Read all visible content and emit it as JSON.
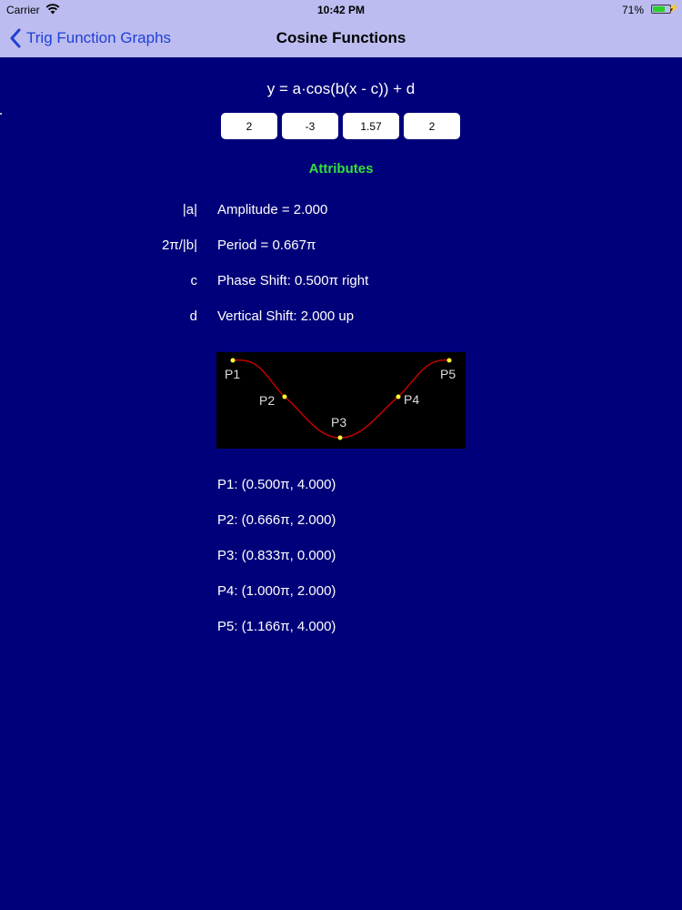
{
  "status_bar": {
    "carrier": "Carrier",
    "time": "10:42 PM",
    "battery_percent": "71%",
    "battery_level": 0.71,
    "battery_color": "#2bd12b"
  },
  "nav": {
    "back_label": "Trig Function Graphs",
    "title": "Cosine Functions"
  },
  "formula": "y = a·cos(b(x - c)) + d",
  "inputs": {
    "a": "2",
    "b": "-3",
    "c": "1.57",
    "d": "2"
  },
  "attributes": {
    "heading": "Attributes",
    "rows": [
      {
        "label": "|a|",
        "value": "Amplitude = 2.000"
      },
      {
        "label": "2π/|b|",
        "value": "Period = 0.667π"
      },
      {
        "label": "c",
        "value": "Phase Shift: 0.500π right"
      },
      {
        "label": "d",
        "value": "Vertical Shift: 2.000 up"
      }
    ]
  },
  "graph": {
    "curve_color": "#c00000",
    "point_color": "#ffff33",
    "labels": [
      "P1",
      "P2",
      "P3",
      "P4",
      "P5"
    ]
  },
  "points": [
    "P1: (0.500π, 4.000)",
    "P2: (0.666π, 2.000)",
    "P3: (0.833π, 0.000)",
    "P4: (1.000π, 2.000)",
    "P5: (1.166π, 4.000)"
  ],
  "colors": {
    "background": "#00007a",
    "nav_background": "#bcbcf0",
    "back_tint": "#1f3fd6",
    "heading": "#33e03a"
  }
}
